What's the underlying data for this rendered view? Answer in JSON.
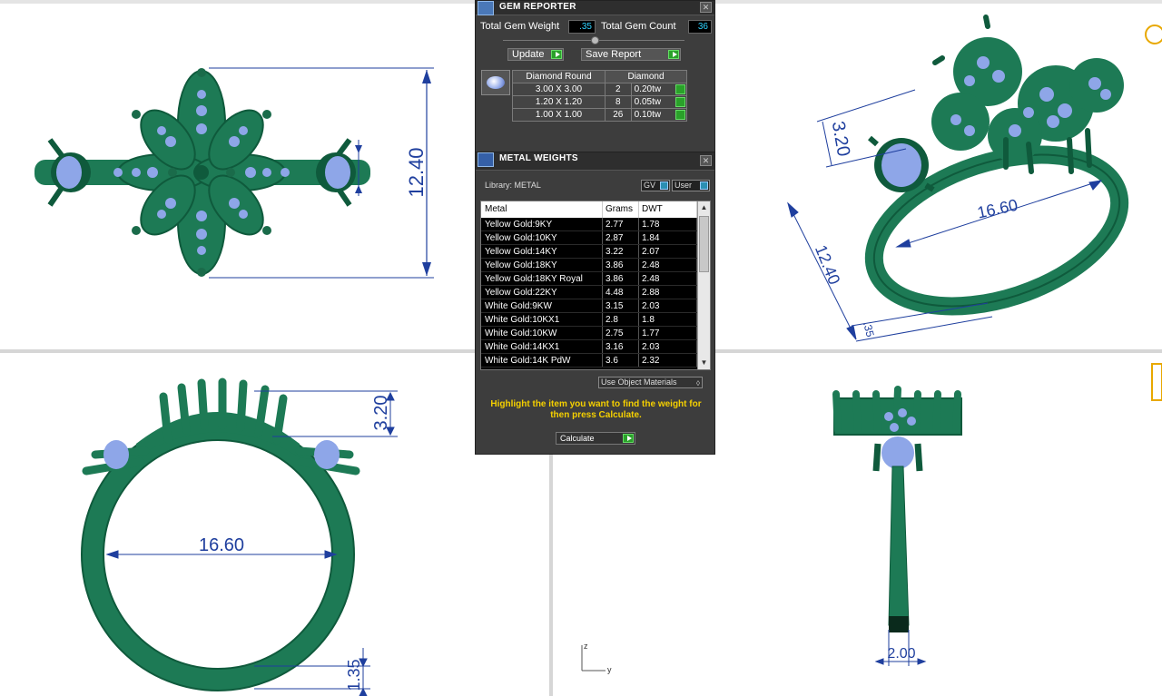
{
  "gem_reporter": {
    "title": "GEM REPORTER",
    "total_weight_label": "Total Gem Weight",
    "total_weight_value": ".35",
    "total_count_label": "Total Gem Count",
    "total_count_value": "36",
    "update_label": "Update",
    "save_report_label": "Save Report",
    "table_headers": [
      "Diamond Round",
      "Diamond"
    ],
    "rows": [
      {
        "size": "3.00 X 3.00",
        "count": "2",
        "weight": "0.20tw"
      },
      {
        "size": "1.20 X 1.20",
        "count": "8",
        "weight": "0.05tw"
      },
      {
        "size": "1.00 X 1.00",
        "count": "26",
        "weight": "0.10tw"
      }
    ]
  },
  "metal_weights": {
    "title": "METAL WEIGHTS",
    "library_label": "Library: METAL",
    "gv_label": "GV",
    "user_label": "User",
    "col_metal": "Metal",
    "col_grams": "Grams",
    "col_dwt": "DWT",
    "rows": [
      {
        "metal": "Yellow Gold:9KY",
        "grams": "2.77",
        "dwt": "1.78"
      },
      {
        "metal": "Yellow Gold:10KY",
        "grams": "2.87",
        "dwt": "1.84"
      },
      {
        "metal": "Yellow Gold:14KY",
        "grams": "3.22",
        "dwt": "2.07"
      },
      {
        "metal": "Yellow Gold:18KY",
        "grams": "3.86",
        "dwt": "2.48"
      },
      {
        "metal": "Yellow Gold:18KY Royal",
        "grams": "3.86",
        "dwt": "2.48"
      },
      {
        "metal": "Yellow Gold:22KY",
        "grams": "4.48",
        "dwt": "2.88"
      },
      {
        "metal": "White Gold:9KW",
        "grams": "3.15",
        "dwt": "2.03"
      },
      {
        "metal": "White Gold:10KX1",
        "grams": "2.8",
        "dwt": "1.8"
      },
      {
        "metal": "White Gold:10KW",
        "grams": "2.75",
        "dwt": "1.77"
      },
      {
        "metal": "White Gold:14KX1",
        "grams": "3.16",
        "dwt": "2.03"
      },
      {
        "metal": "White Gold:14K PdW",
        "grams": "3.6",
        "dwt": "2.32"
      }
    ],
    "use_object_materials": "Use Object Materials",
    "hint": "Highlight the item you want to find the weight for then press Calculate.",
    "calculate_label": "Calculate"
  },
  "dimensions": {
    "top_height": "12.40",
    "persp_height": "3.20",
    "persp_width": "16.60",
    "persp_depth": "12.40",
    "persp_band": ".35",
    "front_height": "3.20",
    "front_inner": "16.60",
    "front_band": "1.35",
    "side_band": "2.00"
  },
  "axis": {
    "z": "z",
    "y": "y"
  },
  "colors": {
    "metal": "#1d7a55",
    "gem": "#8ea6e8",
    "dimension": "#1f3f9e",
    "panel": "#3d3d3d",
    "hint": "#f5d000"
  }
}
